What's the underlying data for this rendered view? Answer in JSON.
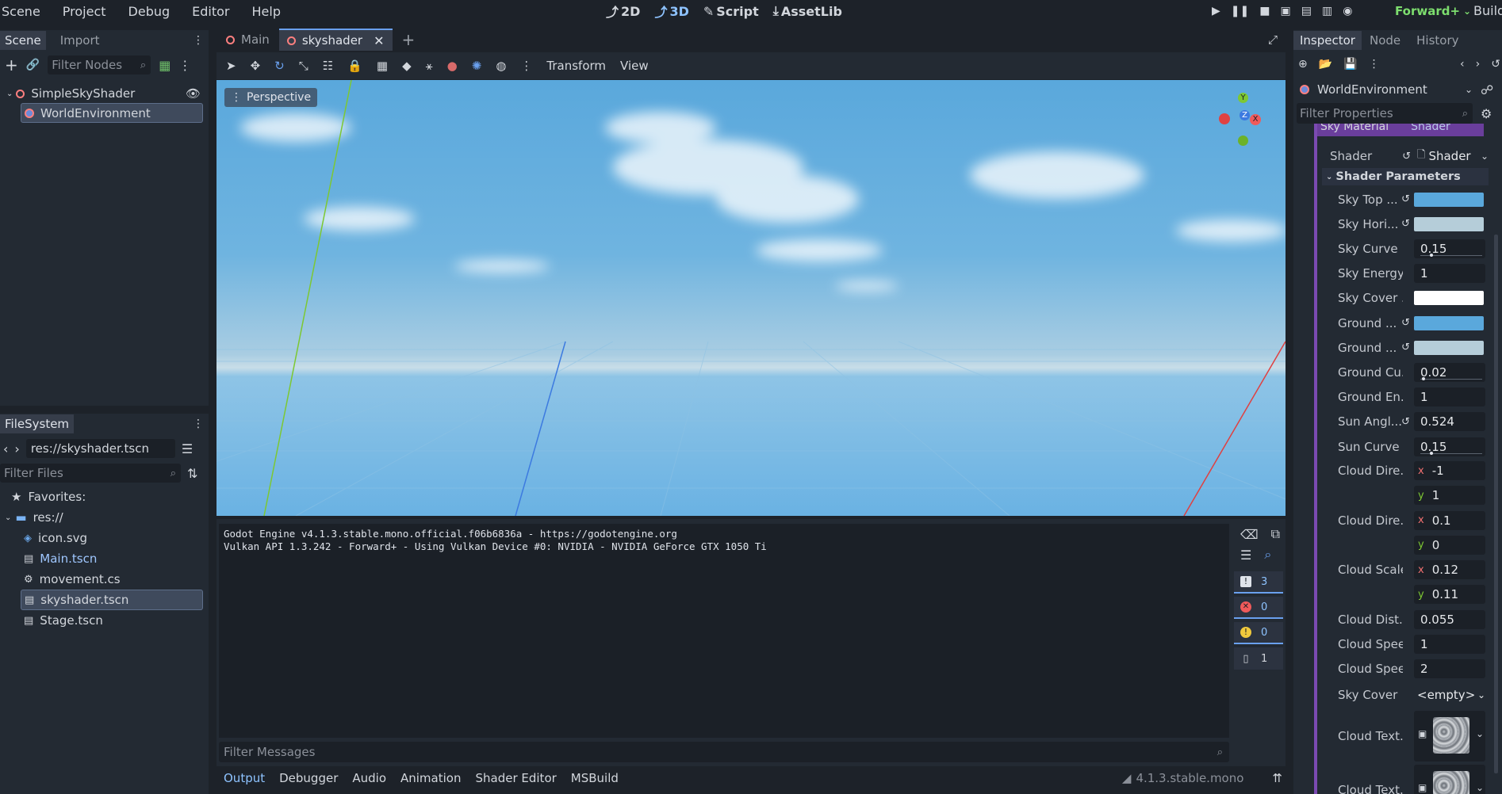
{
  "menubar": {
    "items": [
      "Scene",
      "Project",
      "Debug",
      "Editor",
      "Help"
    ],
    "workspaces": [
      {
        "label": "2D",
        "icon": "2d-icon"
      },
      {
        "label": "3D",
        "icon": "3d-icon"
      },
      {
        "label": "Script",
        "icon": "script-icon"
      },
      {
        "label": "AssetLib",
        "icon": "assetlib-icon"
      }
    ],
    "renderer": "Forward+",
    "build_label": "Build"
  },
  "scene_dock": {
    "tabs": [
      "Scene",
      "Import"
    ],
    "filter_placeholder": "Filter Nodes",
    "tree": [
      {
        "name": "SimpleSkyShader",
        "icon": "node3d-icon"
      },
      {
        "name": "WorldEnvironment",
        "icon": "world-environment-icon",
        "selected": true
      }
    ]
  },
  "filesystem_dock": {
    "title": "FileSystem",
    "path": "res://skyshader.tscn",
    "filter_placeholder": "Filter Files",
    "favorites": "Favorites:",
    "root": "res://",
    "files": [
      {
        "name": "icon.svg",
        "icon": "svg-icon"
      },
      {
        "name": "Main.tscn",
        "icon": "scene-icon",
        "highlight": true
      },
      {
        "name": "movement.cs",
        "icon": "csharp-icon"
      },
      {
        "name": "skyshader.tscn",
        "icon": "scene-icon",
        "selected": true
      },
      {
        "name": "Stage.tscn",
        "icon": "scene-icon"
      }
    ]
  },
  "editor_tabs": [
    "Main",
    "skyshader"
  ],
  "toolbar": {
    "transform_label": "Transform",
    "view_label": "View"
  },
  "viewport": {
    "perspective_label": "Perspective",
    "gizmo": {
      "y": "Y",
      "z": "Z",
      "x": "X"
    }
  },
  "output": {
    "lines": [
      "Godot Engine v4.1.3.stable.mono.official.f06b6836a - https://godotengine.org",
      "Vulkan API 1.3.242 - Forward+ - Using Vulkan Device #0: NVIDIA - NVIDIA GeForce GTX 1050 Ti"
    ],
    "counts": {
      "messages": "3",
      "errors": "0",
      "warnings": "0",
      "info": "1"
    },
    "filter_placeholder": "Filter Messages"
  },
  "bottom_panel": {
    "tabs": [
      "Output",
      "Debugger",
      "Audio",
      "Animation",
      "Shader Editor",
      "MSBuild"
    ],
    "version": "4.1.3.stable.mono"
  },
  "inspector": {
    "tabs": [
      "Inspector",
      "Node",
      "History"
    ],
    "node_name": "WorldEnvironment",
    "filter_placeholder": "Filter Properties",
    "sky_material_label": "Sky Material",
    "sky_material_value": "Shader",
    "shader_label": "Shader",
    "shader_value": "Shader",
    "section": "Shader Parameters",
    "params": [
      {
        "label": "Sky Top ...",
        "type": "color",
        "color": "#5aa8dc",
        "revert": true
      },
      {
        "label": "Sky Hori...",
        "type": "color",
        "color": "#b5cdd9",
        "revert": true
      },
      {
        "label": "Sky Curve",
        "type": "slider",
        "value": "0.15",
        "fraction": 0.15
      },
      {
        "label": "Sky Energy",
        "type": "number",
        "value": "1"
      },
      {
        "label": "Sky Cover ...",
        "type": "color",
        "color": "#ffffff"
      },
      {
        "label": "Ground ...",
        "type": "color",
        "color": "#5aa8dc",
        "revert": true
      },
      {
        "label": "Ground ...",
        "type": "color",
        "color": "#b5cdd9",
        "revert": true
      },
      {
        "label": "Ground Cu...",
        "type": "slider",
        "value": "0.02",
        "fraction": 0.02
      },
      {
        "label": "Ground En...",
        "type": "number",
        "value": "1"
      },
      {
        "label": "Sun Angl...",
        "type": "number",
        "value": "0.524",
        "revert": true
      },
      {
        "label": "Sun Curve",
        "type": "slider",
        "value": "0.15",
        "fraction": 0.15
      }
    ],
    "cloud_dir1": {
      "label": "Cloud Dire...",
      "x": "-1",
      "y": "1"
    },
    "cloud_dir2": {
      "label": "Cloud Dire...",
      "x": "0.1",
      "y": "0"
    },
    "cloud_scale": {
      "label": "Cloud Scale",
      "x": "0.12",
      "y": "0.11"
    },
    "params2": [
      {
        "label": "Cloud Dist...",
        "value": "0.055"
      },
      {
        "label": "Cloud Speed",
        "value": "1"
      },
      {
        "label": "Cloud Spee...",
        "value": "2"
      }
    ],
    "sky_cover": {
      "label": "Sky Cover",
      "value": "<empty>"
    },
    "cloud_tex1": "Cloud Text...",
    "cloud_tex2": "Cloud Text..."
  }
}
